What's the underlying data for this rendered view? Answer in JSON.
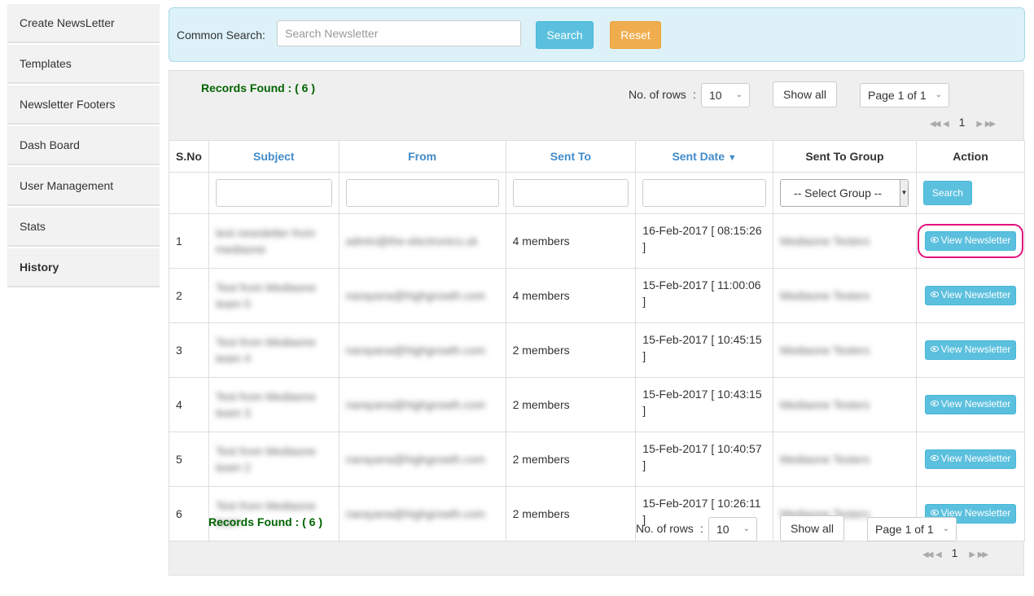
{
  "sidebar": {
    "items": [
      {
        "label": "Create NewsLetter"
      },
      {
        "label": "Templates"
      },
      {
        "label": "Newsletter Footers"
      },
      {
        "label": "Dash Board"
      },
      {
        "label": "User Management"
      },
      {
        "label": "Stats"
      },
      {
        "label": "History"
      }
    ],
    "active": "History"
  },
  "search": {
    "label": "Common Search:",
    "placeholder": "Search Newsletter",
    "search_button": "Search",
    "reset_button": "Reset"
  },
  "pagination_top": {
    "records_found": "Records Found : ( 6 )",
    "rows_label": "No. of rows",
    "rows_sep": ":",
    "rows_value": "10",
    "show_all": "Show all",
    "page_select": "Page 1 of 1",
    "current_page": "1"
  },
  "pagination_bottom": {
    "records_found": "Records Found : ( 6 )",
    "rows_label": "No. of rows",
    "rows_sep": ":",
    "rows_value": "10",
    "show_all": "Show all",
    "page_select": "Page 1 of 1",
    "current_page": "1"
  },
  "table": {
    "headers": [
      "S.No",
      "Subject",
      "From",
      "Sent To",
      "Sent Date",
      "Sent To Group",
      "Action"
    ],
    "sort_indicator": "▼",
    "filter": {
      "group_placeholder": "-- Select Group --",
      "search_button": "Search"
    },
    "rows": [
      {
        "sno": "1",
        "subject": "test newsletter from mediaone",
        "from": "admin@the-electronics.uk",
        "sent_to": "4 members",
        "sent_date": "16-Feb-2017 [ 08:15:26 ]",
        "group": "Mediaone Testers",
        "action": "View Newsletter"
      },
      {
        "sno": "2",
        "subject": "Test from Mediaone team 5",
        "from": "narayana@highgrowth.com",
        "sent_to": "4 members",
        "sent_date": "15-Feb-2017 [ 11:00:06 ]",
        "group": "Mediaone Testers",
        "action": "View Newsletter"
      },
      {
        "sno": "3",
        "subject": "Test from Mediaone team 4",
        "from": "narayana@highgrowth.com",
        "sent_to": "2 members",
        "sent_date": "15-Feb-2017 [ 10:45:15 ]",
        "group": "Mediaone Testers",
        "action": "View Newsletter"
      },
      {
        "sno": "4",
        "subject": "Test from Mediaone team 3",
        "from": "narayana@highgrowth.com",
        "sent_to": "2 members",
        "sent_date": "15-Feb-2017 [ 10:43:15 ]",
        "group": "Mediaone Testers",
        "action": "View Newsletter"
      },
      {
        "sno": "5",
        "subject": "Test from Mediaone team 2",
        "from": "narayana@highgrowth.com",
        "sent_to": "2 members",
        "sent_date": "15-Feb-2017 [ 10:40:57 ]",
        "group": "Mediaone Testers",
        "action": "View Newsletter"
      },
      {
        "sno": "6",
        "subject": "Test from Mediaone team",
        "from": "narayana@highgrowth.com",
        "sent_to": "2 members",
        "sent_date": "15-Feb-2017 [ 10:26:11 ]",
        "group": "Mediaone Testers",
        "action": "View Newsletter"
      }
    ]
  },
  "colors": {
    "info": "#5bc0de",
    "warning": "#f0ad4e",
    "records_green": "#006400",
    "sort_link": "#428bca",
    "highlight": "#e3127b"
  }
}
